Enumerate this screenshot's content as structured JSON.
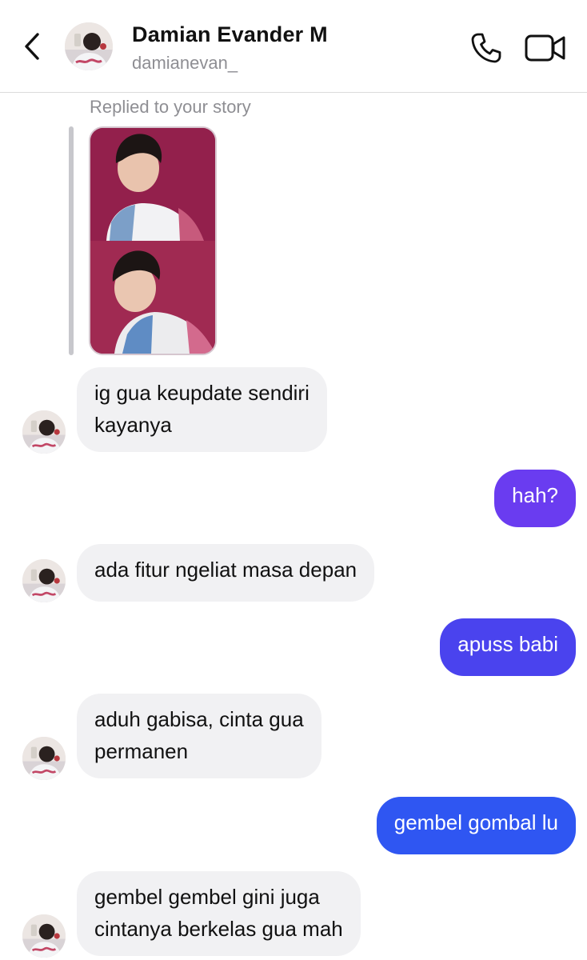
{
  "header": {
    "name": "Damian Evander M",
    "username": "damianevan_"
  },
  "story_reply": {
    "note": "Replied to your story"
  },
  "messages": [
    {
      "side": "in",
      "line1": "ig gua keupdate sendiri",
      "line2": "kayanya"
    },
    {
      "side": "out",
      "line1": "hah?",
      "color": "#6a3cf0"
    },
    {
      "side": "in",
      "line1": "ada fitur ngeliat masa depan"
    },
    {
      "side": "out",
      "line1": "apuss babi",
      "color": "#4a43ee"
    },
    {
      "side": "in",
      "line1": "aduh gabisa, cinta gua",
      "line2": "permanen"
    },
    {
      "side": "out",
      "line1": "gembel gombal lu",
      "color": "#2f56f2"
    },
    {
      "side": "in",
      "line1": "gembel gembel gini juga",
      "line2": "cintanya berkelas gua mah"
    }
  ],
  "icons": {
    "back": "chevron-left-icon",
    "call": "phone-icon",
    "video": "video-camera-icon"
  }
}
